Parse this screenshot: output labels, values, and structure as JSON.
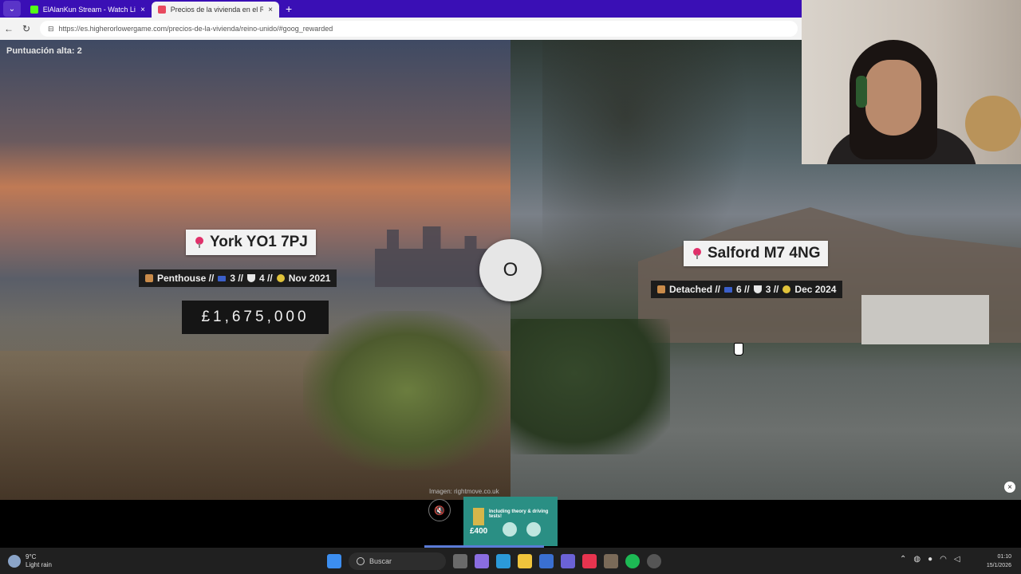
{
  "browser": {
    "tabs": [
      {
        "label": "ElAlanKun Stream - Watch Live on",
        "favicon_color": "#53fc18",
        "active": false
      },
      {
        "label": "Precios de la vivienda en el Reino",
        "favicon_color": "#e84a5f",
        "active": true
      }
    ],
    "url": "https://es.higherorlowergame.com/precios-de-la-vivienda/reino-unido/#goog_rewarded"
  },
  "game": {
    "high_score": "Puntuación alta: 2",
    "vs_label": "O",
    "left": {
      "location": "York YO1 7PJ",
      "type": "Penthouse //",
      "beds": "3 //",
      "baths": "4 //",
      "date": "Nov 2021",
      "price": "£1,675,000"
    },
    "right": {
      "location": "Salford M7 4NG",
      "type": "Detached //",
      "beds": "6 //",
      "baths": "3 //",
      "date": "Dec 2024"
    },
    "image_credit": "Imagen: rightmove.co.uk"
  },
  "ad": {
    "text": "Including theory & driving tests!",
    "price": "£400"
  },
  "taskbar": {
    "temperature": "9°C",
    "weather": "Light rain",
    "search_placeholder": "Buscar",
    "time": "01:10",
    "date": "15/1/2026"
  }
}
